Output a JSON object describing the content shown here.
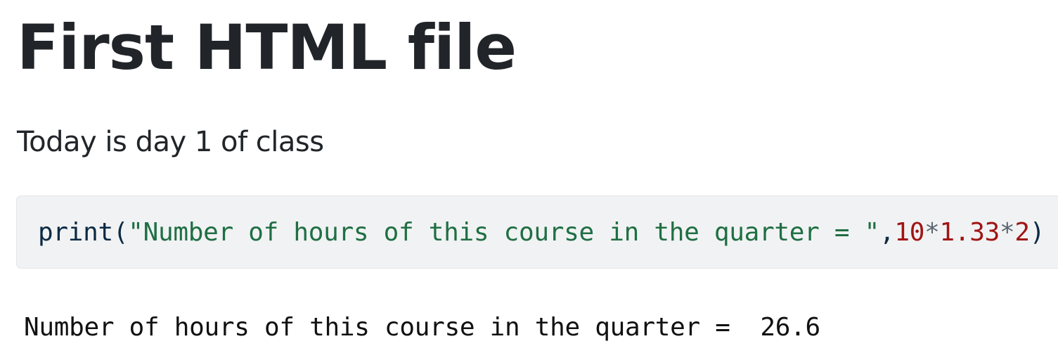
{
  "page": {
    "title": "First HTML file",
    "intro": "Today is day 1 of class"
  },
  "code_cell": {
    "tokens": {
      "func": "print",
      "open_paren": "(",
      "string": "\"Number of hours of this course in the quarter = \"",
      "comma": ",",
      "num1": "10",
      "op1": "*",
      "num2": "1.33",
      "op2": "*",
      "num3": "2",
      "close_paren": ")"
    },
    "colors": {
      "function": "#0c2a44",
      "string": "#1f6f43",
      "number": "#a01515",
      "operator": "#5c6670",
      "background": "#f1f2f3"
    }
  },
  "output": {
    "text": "Number of hours of this course in the quarter =  26.6"
  }
}
